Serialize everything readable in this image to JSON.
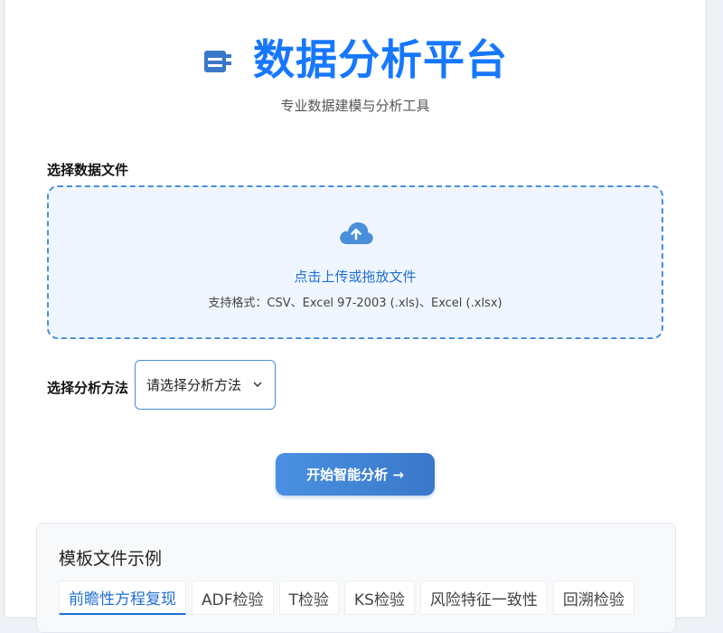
{
  "header": {
    "title": "数据分析平台",
    "subtitle": "专业数据建模与分析工具"
  },
  "upload": {
    "label": "选择数据文件",
    "main_text": "点击上传或拖放文件",
    "hint": "支持格式：CSV、Excel 97-2003 (.xls)、Excel (.xlsx)"
  },
  "method": {
    "label": "选择分析方法",
    "placeholder": "请选择分析方法"
  },
  "actions": {
    "start_label": "开始智能分析 →"
  },
  "templates": {
    "title": "模板文件示例",
    "tabs": [
      {
        "label": "前瞻性方程复现",
        "active": true
      },
      {
        "label": "ADF检验"
      },
      {
        "label": "T检验"
      },
      {
        "label": "KS检验"
      },
      {
        "label": "风险特征一致性"
      },
      {
        "label": "回溯检验"
      }
    ]
  },
  "colors": {
    "accent": "#1677ff",
    "button": "#4a90e2",
    "dropzone_border": "#4a8fd9",
    "dropzone_bg": "#f0f6ff"
  }
}
